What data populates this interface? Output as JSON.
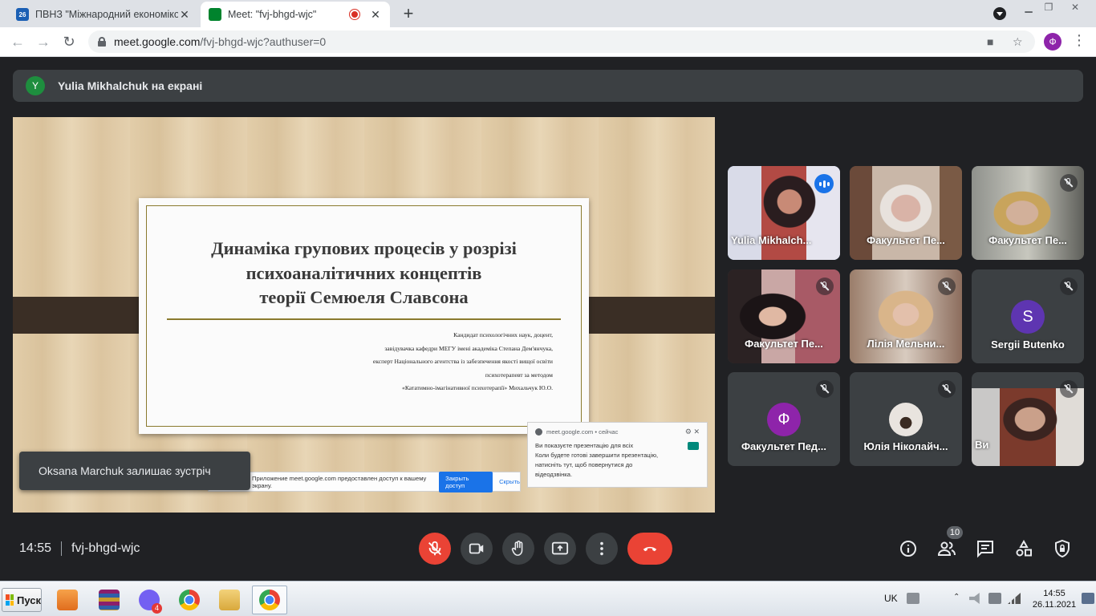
{
  "browser": {
    "tabs": [
      {
        "title": "ПВНЗ \"Міжнародний економіко",
        "favicon_text": "26",
        "active": false
      },
      {
        "title": "Meet: \"fvj-bhgd-wjc\"",
        "active": true
      }
    ],
    "url_host": "meet.google.com",
    "url_path": "/fvj-bhgd-wjc?authuser=0",
    "profile_initial": "Ф"
  },
  "meet": {
    "presenter_bar": {
      "avatar": "Y",
      "text": "Yulia Mikhalchuk на екрані"
    },
    "slide": {
      "title_lines": [
        "Динаміка групових процесів у розрізі",
        "психоаналітичних концептів",
        "теорії Семюеля Славсона"
      ],
      "subtitle_lines": [
        "Кандидат психологічних наук, доцент,",
        "завідувачка кафедри МЕГУ імені академіка Степана Дем'янчука,",
        "експерт Національного агентства із забезпечення якості вищої освіти",
        "психотерапевт за методом",
        "«Кататимно-імагінативної психотерапії» Михальчук Ю.О."
      ]
    },
    "share_notification": {
      "source": "meet.google.com",
      "time": "сейчас",
      "line1": "Ви показуєте презентацію для всіх",
      "line2": "Коли будете готові завершити презентацію,",
      "line3": "натисніть тут, щоб повернутися до",
      "line4": "відеодзвінка."
    },
    "share_bar": {
      "text": "Приложение meet.google.com предоставлен доступ к вашему экрану.",
      "stop_label": "Закрыть доступ",
      "hide_label": "Скрыть"
    },
    "toast": "Oksana Marchuk залишає зустріч",
    "participants": [
      {
        "name": "Yulia Mikhalch...",
        "speaking": true
      },
      {
        "name": "Факультет Пе...",
        "muted": false
      },
      {
        "name": "Факультет Пе...",
        "muted": true
      },
      {
        "name": "Факультет Пе...",
        "muted": true
      },
      {
        "name": "Лілія Мельни...",
        "muted": true
      },
      {
        "name": "Sergii Butenko",
        "initial": "S",
        "avatar_color": "#5e35b1",
        "muted": true
      },
      {
        "name": "Факультет Пед...",
        "initial": "Ф",
        "avatar_color": "#8e24aa",
        "muted": true
      },
      {
        "name": "Юлія Ніколайч...",
        "muted": true
      },
      {
        "name": "Ви",
        "muted": true
      }
    ],
    "time": "14:55",
    "meeting_code": "fvj-bhgd-wjc",
    "people_count": "10"
  },
  "taskbar": {
    "start_label": "Пуск",
    "viber_badge": "4",
    "lang": "UK",
    "time": "14:55",
    "date": "26.11.2021"
  }
}
